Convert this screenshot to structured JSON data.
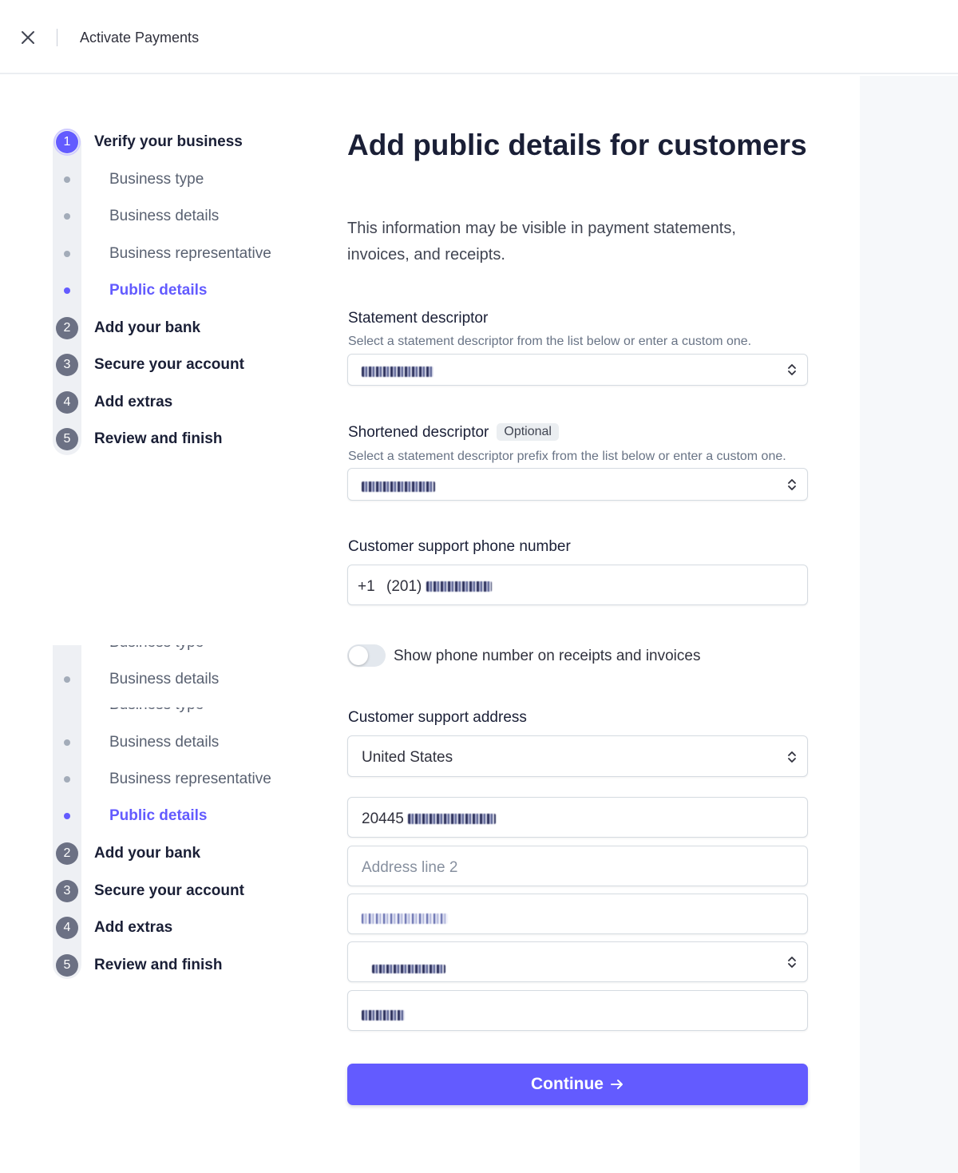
{
  "header": {
    "title": "Activate Payments"
  },
  "stepper": {
    "steps": [
      {
        "number": "1",
        "label": "Verify your business",
        "substeps": [
          "Business type",
          "Business details",
          "Business representative",
          "Public details"
        ],
        "active_substep": "Public details"
      },
      {
        "number": "2",
        "label": "Add your bank"
      },
      {
        "number": "3",
        "label": "Secure your account"
      },
      {
        "number": "4",
        "label": "Add extras"
      },
      {
        "number": "5",
        "label": "Review and finish"
      }
    ]
  },
  "stepper_ghost": {
    "cut_label": "Business type",
    "substeps": [
      "Business details",
      "Business details",
      "Business representative",
      "Public details"
    ],
    "steps": [
      {
        "number": "2",
        "label": "Add your bank"
      },
      {
        "number": "3",
        "label": "Secure your account"
      },
      {
        "number": "4",
        "label": "Add extras"
      },
      {
        "number": "5",
        "label": "Review and finish"
      }
    ]
  },
  "form": {
    "title": "Add public details for customers",
    "subtitle": "This information may be visible in payment statements, invoices, and receipts.",
    "statement_descriptor": {
      "label": "Statement descriptor",
      "hint": "Select a statement descriptor from the list below or enter a custom one."
    },
    "shortened_descriptor": {
      "label": "Shortened descriptor",
      "badge": "Optional",
      "hint": "Select a statement descriptor prefix from the list below or enter a custom one."
    },
    "phone": {
      "label": "Customer support phone number",
      "country_code": "+1",
      "area_code": "(201)"
    },
    "show_phone_toggle": {
      "label": "Show phone number on receipts and invoices",
      "on": false
    },
    "address": {
      "label": "Customer support address",
      "country": "United States",
      "line1_visible": "20445",
      "line2_placeholder": "Address line 2"
    },
    "continue_label": "Continue"
  }
}
